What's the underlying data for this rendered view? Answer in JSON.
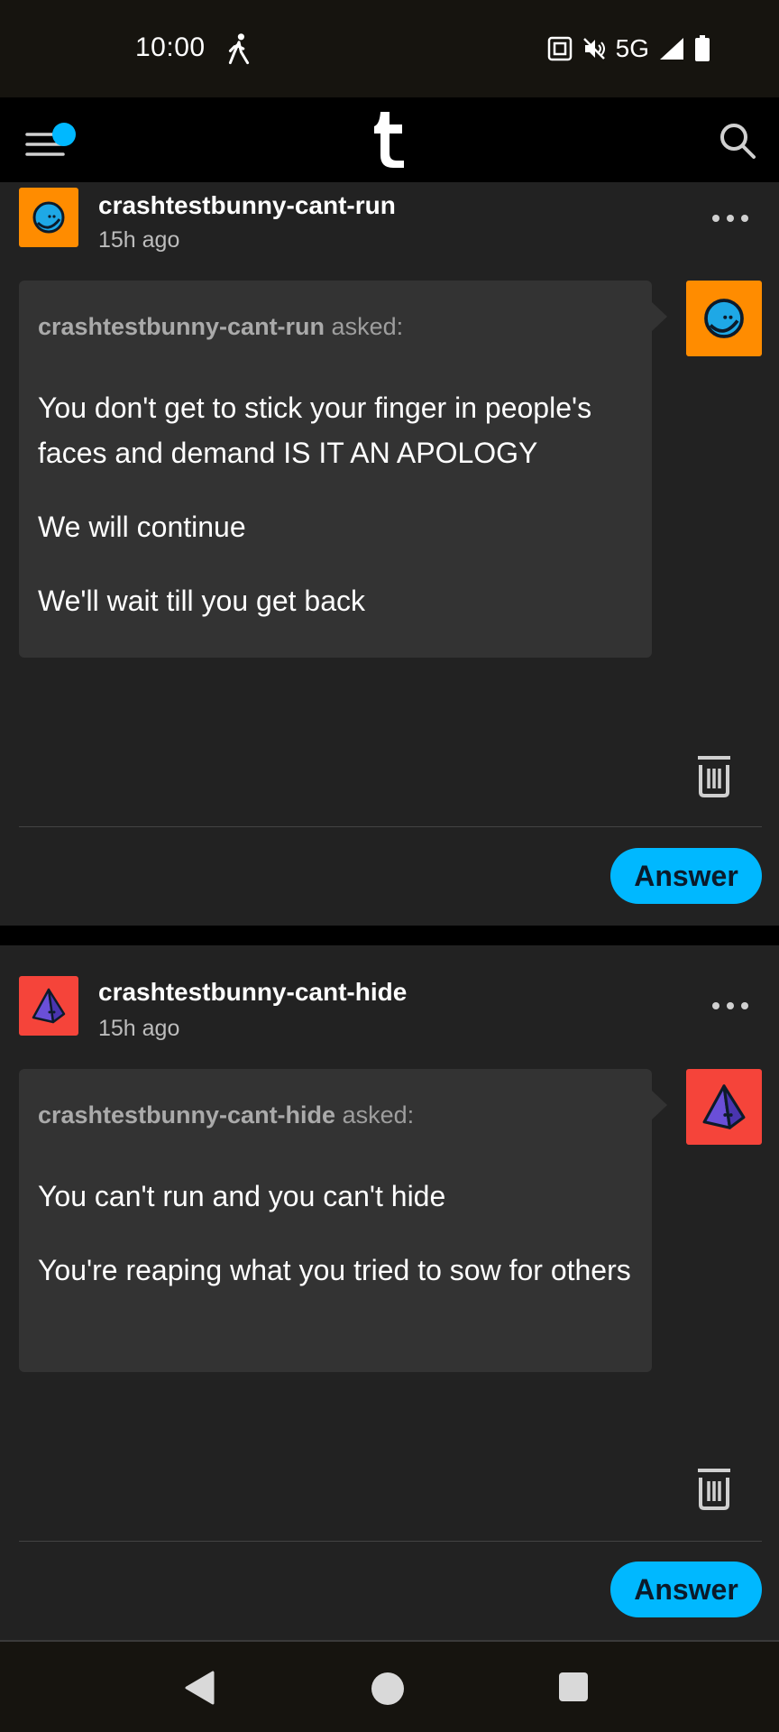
{
  "status_bar": {
    "time": "10:00",
    "network": "5G",
    "icons": [
      "walk-icon",
      "nfc-icon",
      "mute-icon",
      "signal-icon",
      "battery-icon"
    ]
  },
  "app_bar": {
    "logo": "t",
    "icons": [
      "menu-icon",
      "search-icon"
    ],
    "notification_color": "#00b8ff"
  },
  "posts": [
    {
      "blog_name": "crashtestbunny-cant-run",
      "time": "15h ago",
      "asker": "crashtestbunny-cant-run",
      "asked_label": " asked:",
      "lines": [
        "You don't get to stick your finger in people's faces and demand IS IT AN APOLOGY",
        "We will continue",
        "We'll wait till you get back"
      ],
      "avatar_color": "#ff8c00",
      "avatar_icon": "blue-face-icon",
      "answer_label": "Answer"
    },
    {
      "blog_name": "crashtestbunny-cant-hide",
      "time": "15h ago",
      "asker": "crashtestbunny-cant-hide",
      "asked_label": " asked:",
      "lines": [
        "You can't run and you can't hide",
        "You're reaping what you tried to sow for others"
      ],
      "avatar_color": "#f5443a",
      "avatar_icon": "pyramid-icon",
      "answer_label": "Answer"
    }
  ],
  "colors": {
    "accent": "#00b8ff",
    "background": "#222222",
    "bubble": "#333333"
  }
}
